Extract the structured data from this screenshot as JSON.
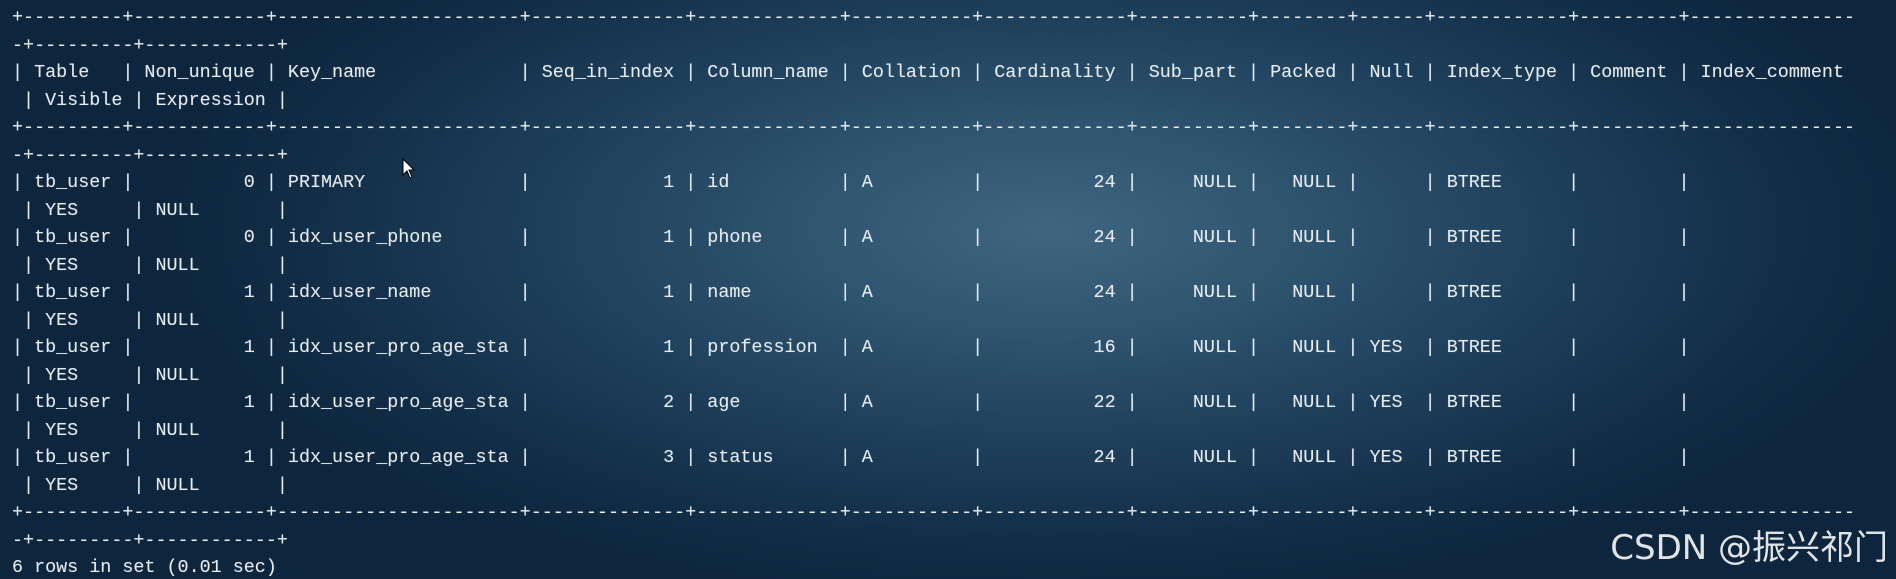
{
  "terminal": {
    "lines": [
      "+---------+------------+----------------------+--------------+-------------+-----------+-------------+----------+--------+------+------------+---------+---------------",
      "-+---------+------------+",
      "| Table   | Non_unique | Key_name             | Seq_in_index | Column_name | Collation | Cardinality | Sub_part | Packed | Null | Index_type | Comment | Index_comment",
      " | Visible | Expression |",
      "+---------+------------+----------------------+--------------+-------------+-----------+-------------+----------+--------+------+------------+---------+---------------",
      "-+---------+------------+",
      "| tb_user |          0 | PRIMARY              |            1 | id          | A         |          24 |     NULL |   NULL |      | BTREE      |         |",
      " | YES     | NULL       |",
      "| tb_user |          0 | idx_user_phone       |            1 | phone       | A         |          24 |     NULL |   NULL |      | BTREE      |         |",
      " | YES     | NULL       |",
      "| tb_user |          1 | idx_user_name        |            1 | name        | A         |          24 |     NULL |   NULL |      | BTREE      |         |",
      " | YES     | NULL       |",
      "| tb_user |          1 | idx_user_pro_age_sta |            1 | profession  | A         |          16 |     NULL |   NULL | YES  | BTREE      |         |",
      " | YES     | NULL       |",
      "| tb_user |          1 | idx_user_pro_age_sta |            2 | age         | A         |          22 |     NULL |   NULL | YES  | BTREE      |         |",
      " | YES     | NULL       |",
      "| tb_user |          1 | idx_user_pro_age_sta |            3 | status      | A         |          24 |     NULL |   NULL | YES  | BTREE      |         |",
      " | YES     | NULL       |",
      "+---------+------------+----------------------+--------------+-------------+-----------+-------------+----------+--------+------+------------+---------+---------------",
      "-+---------+------------+",
      "6 rows in set (0.01 sec)"
    ]
  },
  "watermark": {
    "text": "CSDN @振兴祁门"
  },
  "cursor": {
    "icon": "mouse-pointer-icon"
  }
}
